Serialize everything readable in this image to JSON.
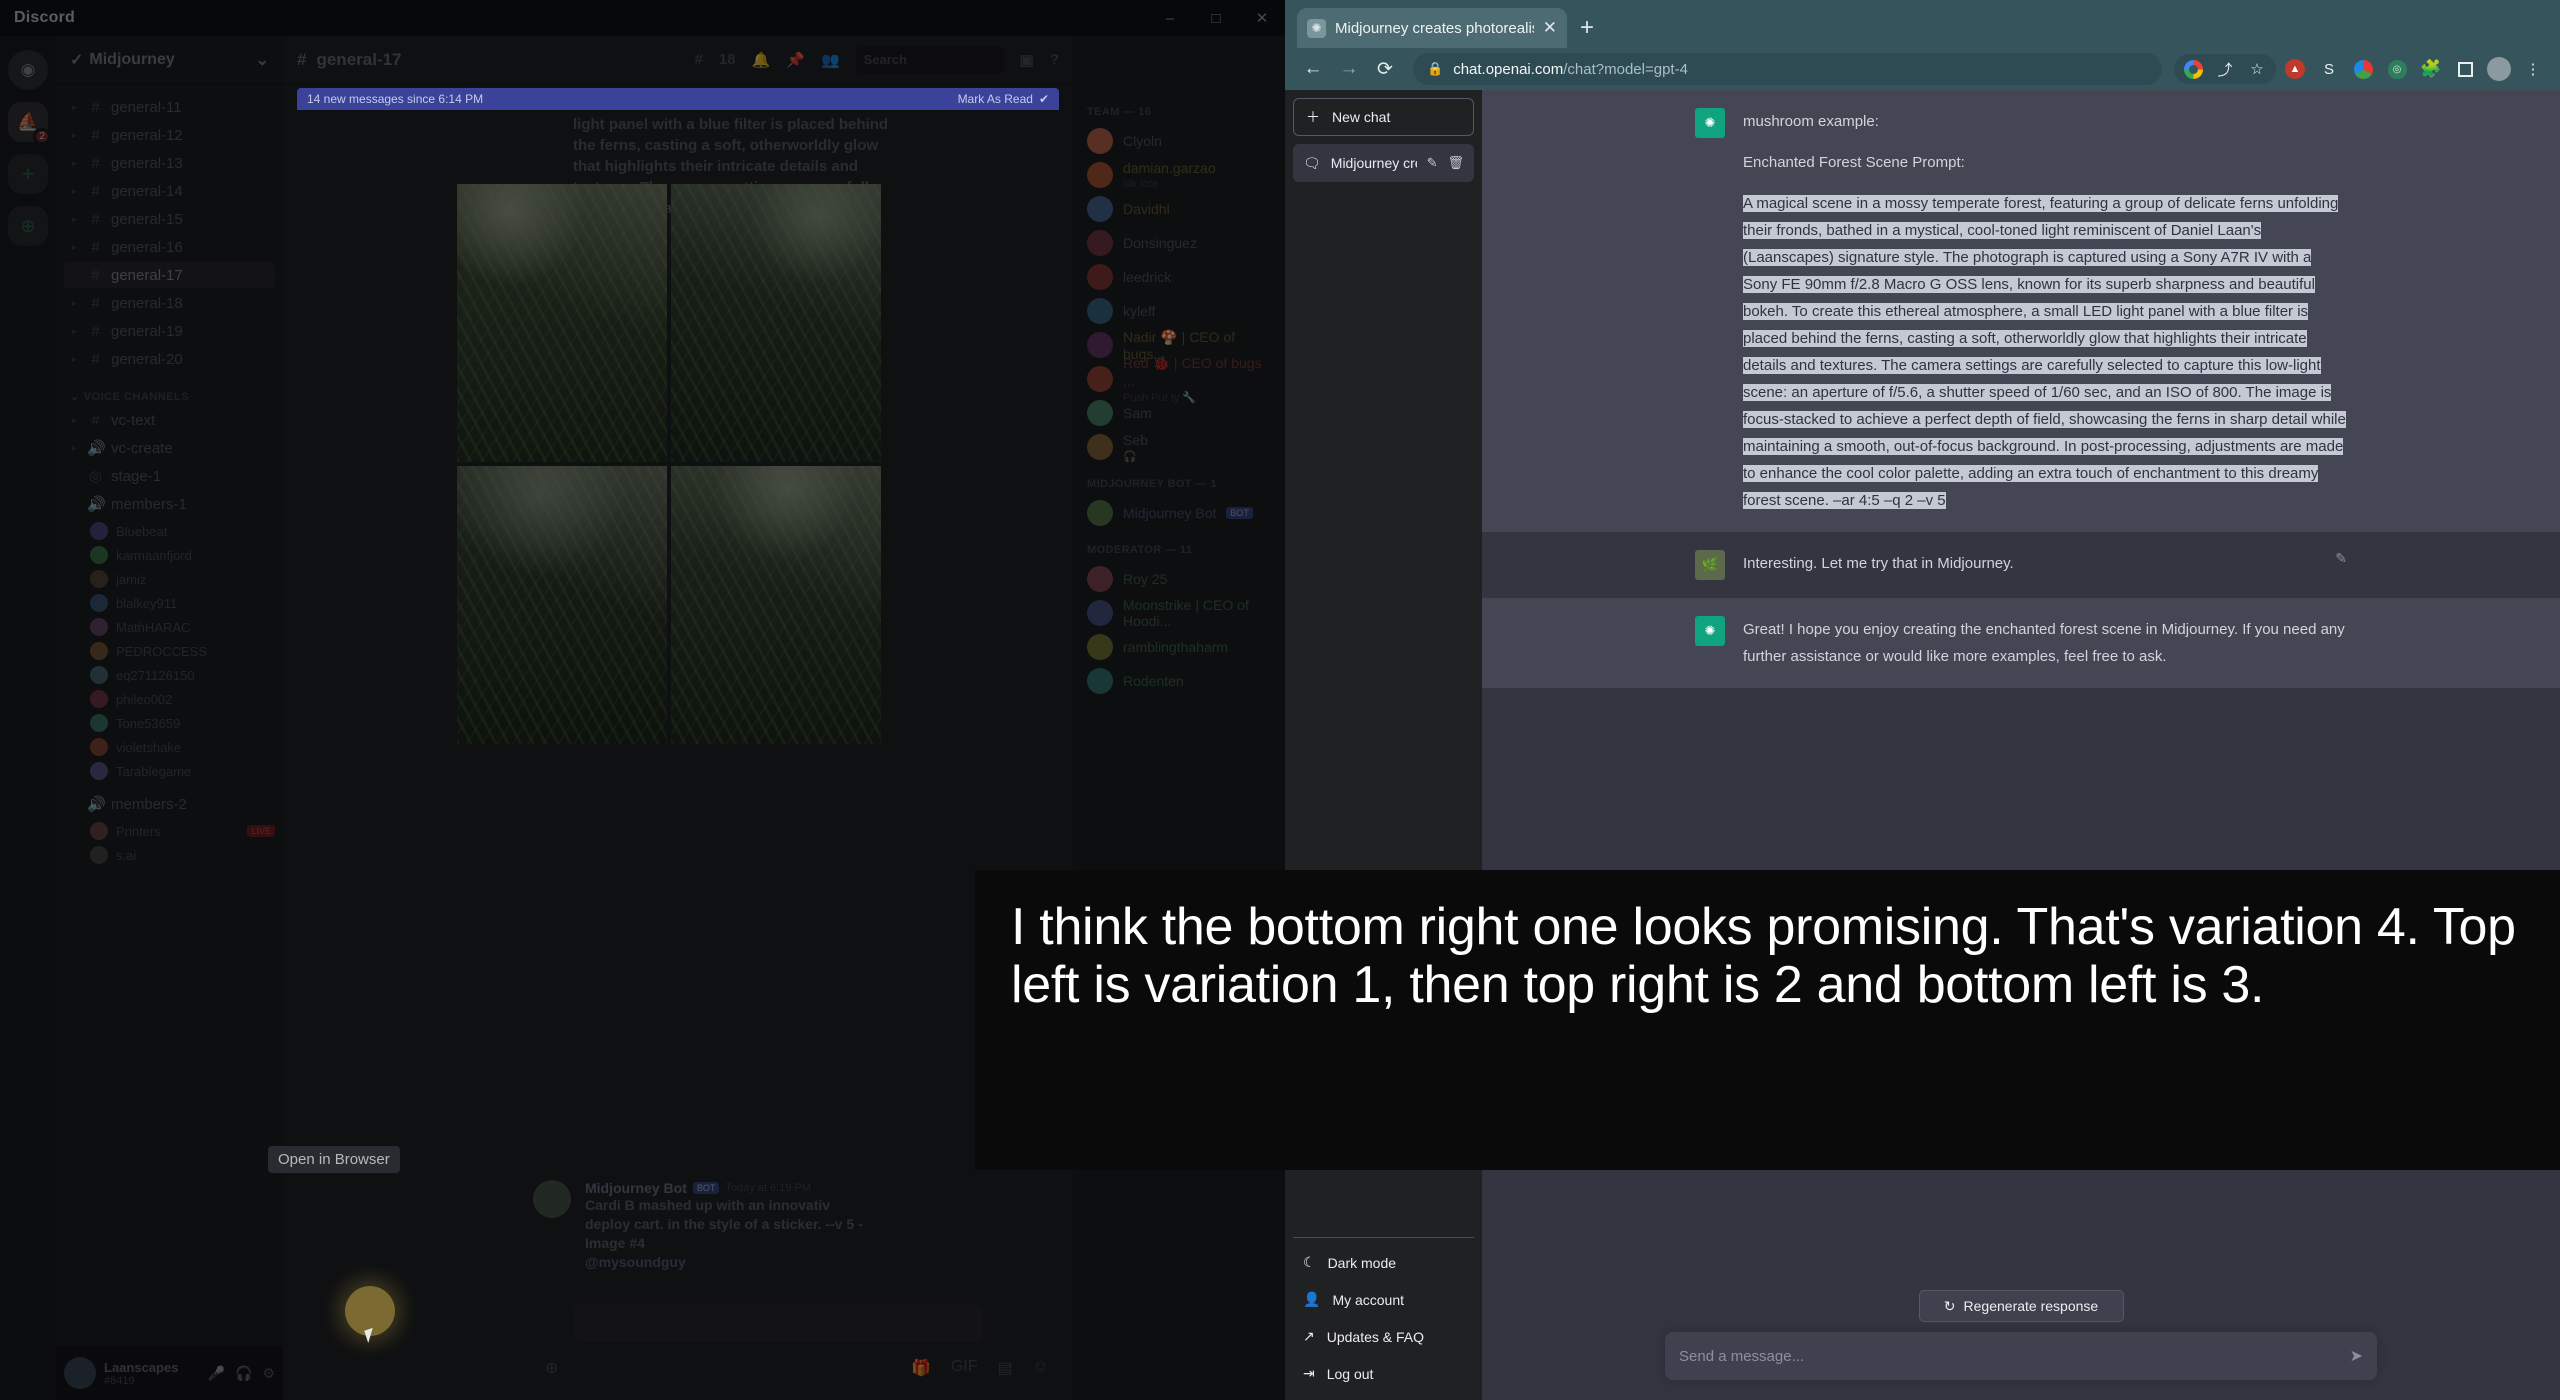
{
  "discord": {
    "window_title": "Discord",
    "window_controls": [
      "–",
      "□",
      "✕"
    ],
    "server_name": "Midjourney",
    "channel_header": "general-17",
    "header_counts": "18",
    "search_placeholder": "Search",
    "new_messages_banner": "14 new messages since 6:14 PM",
    "mark_as_read": "Mark As Read",
    "channels": [
      {
        "name": "general-11"
      },
      {
        "name": "general-12"
      },
      {
        "name": "general-13"
      },
      {
        "name": "general-14"
      },
      {
        "name": "general-15"
      },
      {
        "name": "general-16"
      },
      {
        "name": "general-17",
        "active": true
      },
      {
        "name": "general-18"
      },
      {
        "name": "general-19"
      },
      {
        "name": "general-20"
      }
    ],
    "voice_category": "VOICE CHANNELS",
    "voice_channels": [
      {
        "name": "vc-text"
      },
      {
        "name": "vc-create"
      },
      {
        "name": "stage-1"
      },
      {
        "name": "members-1"
      }
    ],
    "voice_members": [
      "Bluebeat",
      "karmaanfjord",
      "jamiz",
      "blalkey911",
      "MathHARAC",
      "PEDROCCESS",
      "eq271126150",
      "phileo002",
      "Tone53659",
      "violetshake",
      "Tarablegame"
    ],
    "members_2_label": "members-2",
    "members_2_list": [
      "Printers",
      "s.ai"
    ],
    "live_badge": "LIVE",
    "user_name": "Laanscapes",
    "user_tag": "#8419",
    "message_snippet": "light panel with a blue filter is placed behind the ferns, casting a soft, otherworldly glow that highlights their intricate details and textures. The camera settings are carefully selected to capture this low-light scene: an",
    "last_message": {
      "author": "Midjourney Bot",
      "bot_badge": "BOT",
      "timestamp": "Today at 6:19 PM",
      "text": "Cardi B mashed up with an innovativ deploy cart. in the style of a sticker. --v 5 - Image #4",
      "mention": "@mysoundguy"
    },
    "member_rail": {
      "team_label": "TEAM — 16",
      "team": [
        {
          "name": "Clyoln",
          "color": "plain"
        },
        {
          "name": "damian.garzao",
          "color": "plain",
          "sub": "idk lore"
        },
        {
          "name": "Davidhl",
          "color": "plain"
        },
        {
          "name": "Donsinguez",
          "color": "plain"
        },
        {
          "name": "leedrick",
          "color": "plain"
        },
        {
          "name": "kyleff",
          "color": "plain"
        },
        {
          "name": "Nadir 🍄 | CEO of bugs...",
          "color": "ylw"
        },
        {
          "name": "Red 🐞 | CEO of bugs ...",
          "color": "red",
          "sub": "Push Put ty 🔧"
        },
        {
          "name": "Sam",
          "color": "plain"
        },
        {
          "name": "Seb",
          "color": "plain",
          "sub": "🎧"
        }
      ],
      "bot_label": "MIDJOURNEY BOT — 1",
      "bots": [
        {
          "name": "Midjourney Bot",
          "badge": "BOT"
        }
      ],
      "mod_label": "MODERATOR — 11",
      "mods": [
        {
          "name": "Roy 25"
        },
        {
          "name": "Moonstrike | CEO of Hoodi..."
        },
        {
          "name": "ramblingthaharm"
        },
        {
          "name": "Rodenten"
        }
      ]
    },
    "browser_tooltip": "Open in Browser"
  },
  "browser": {
    "tab": {
      "title": "Midjourney creates photorealisti",
      "favicon": "openai-icon",
      "close": "✕"
    },
    "new_tab_label": "+",
    "nav": {
      "back": "←",
      "forward": "→",
      "reload": "⟳"
    },
    "omnibox": {
      "lock": "🔒",
      "domain": "chat.openai.com",
      "path": "/chat?model=gpt-4"
    },
    "toolbar_icons": [
      "google-icon",
      "share-icon",
      "bookmark-star-icon",
      "brave-shields-icon",
      "s-extension-icon",
      "color-wheel-extension-icon",
      "green-shield-extension-icon",
      "puzzle-extensions-icon",
      "sidebar-panel-icon",
      "profile-avatar-icon",
      "kebab-menu-icon"
    ],
    "window_controls": [
      "–",
      "□",
      "✕"
    ]
  },
  "chatgpt": {
    "sidebar": {
      "new_chat": "New chat",
      "conversation": "Midjourney creates pho",
      "conversation_actions": [
        "edit-icon",
        "trash-icon"
      ],
      "menu": [
        {
          "label": "Dark mode",
          "icon": "moon-icon"
        },
        {
          "label": "My account",
          "icon": "person-icon"
        },
        {
          "label": "Updates & FAQ",
          "icon": "external-link-icon"
        },
        {
          "label": "Log out",
          "icon": "logout-icon"
        }
      ]
    },
    "messages": [
      {
        "role": "assistant",
        "partial_top": "mushroom example:",
        "heading": "Enchanted Forest Scene Prompt:",
        "selected_body": "A magical scene in a mossy temperate forest, featuring a group of delicate ferns unfolding their fronds, bathed in a mystical, cool-toned light reminiscent of Daniel Laan's (Laanscapes) signature style. The photograph is captured using a Sony A7R IV with a Sony FE 90mm f/2.8 Macro G OSS lens, known for its superb sharpness and beautiful bokeh. To create this ethereal atmosphere, a small LED light panel with a blue filter is placed behind the ferns, casting a soft, otherworldly glow that highlights their intricate details and textures. The camera settings are carefully selected to capture this low-light scene: an aperture of f/5.6, a shutter speed of 1/60 sec, and an ISO of 800. The image is focus-stacked to achieve a perfect depth of field, showcasing the ferns in sharp detail while maintaining a smooth, out-of-focus background. In post-processing, adjustments are made to enhance the cool color palette, adding an extra touch of enchantment to this dreamy forest scene. –ar 4:5 –q 2 –v 5"
      },
      {
        "role": "user",
        "text": "Interesting. Let me try that in Midjourney."
      },
      {
        "role": "assistant",
        "text": "Great! I hope you enjoy creating the enchanted forest scene in Midjourney. If you need any further assistance or would like more examples, feel free to ask."
      }
    ],
    "regenerate_label": "Regenerate response",
    "composer_placeholder": "Send a message...",
    "send_icon": "send-icon"
  },
  "subtitle": {
    "text": "I think the bottom right one looks promising. That's variation 4. Top left is variation 1, then top right is 2 and bottom left is 3."
  }
}
